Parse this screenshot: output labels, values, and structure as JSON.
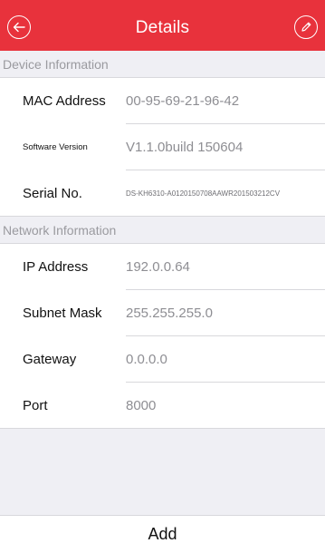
{
  "header": {
    "title": "Details"
  },
  "sections": {
    "device": {
      "title": "Device Information",
      "rows": [
        {
          "label": "MAC Address",
          "value": "00-95-69-21-96-42"
        },
        {
          "label": "Software Version",
          "value": "V1.1.0build 150604"
        },
        {
          "label": "Serial No.",
          "value": "DS-KH6310-A0120150708AAWR201503212CV"
        }
      ]
    },
    "network": {
      "title": "Network Information",
      "rows": [
        {
          "label": "IP Address",
          "value": "192.0.0.64"
        },
        {
          "label": "Subnet Mask",
          "value": "255.255.255.0"
        },
        {
          "label": "Gateway",
          "value": "0.0.0.0"
        },
        {
          "label": "Port",
          "value": "8000"
        }
      ]
    }
  },
  "footer": {
    "add_label": "Add"
  },
  "colors": {
    "header_bg": "#e8323c",
    "background": "#efeff4"
  }
}
